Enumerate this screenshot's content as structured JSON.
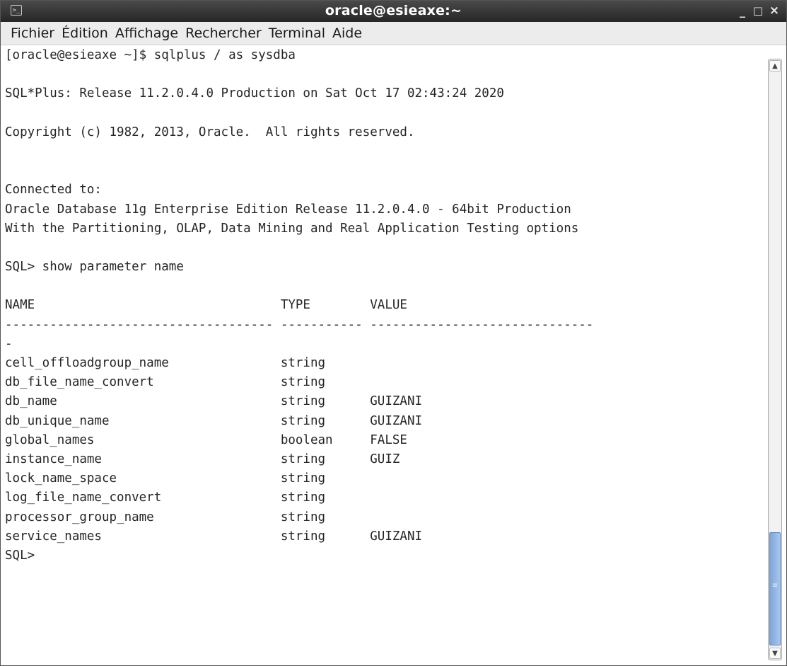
{
  "window": {
    "title": "oracle@esieaxe:~",
    "icon": "terminal-icon",
    "controls": {
      "minimize": "_",
      "maximize": "□",
      "close": "×"
    }
  },
  "menu": [
    {
      "label": "Fichier"
    },
    {
      "label": "Édition"
    },
    {
      "label": "Affichage"
    },
    {
      "label": "Rechercher"
    },
    {
      "label": "Terminal"
    },
    {
      "label": "Aide"
    }
  ],
  "terminal": {
    "lines": [
      "[oracle@esieaxe ~]$ sqlplus / as sysdba",
      "",
      "SQL*Plus: Release 11.2.0.4.0 Production on Sat Oct 17 02:43:24 2020",
      "",
      "Copyright (c) 1982, 2013, Oracle.  All rights reserved.",
      "",
      "",
      "Connected to:",
      "Oracle Database 11g Enterprise Edition Release 11.2.0.4.0 - 64bit Production",
      "With the Partitioning, OLAP, Data Mining and Real Application Testing options",
      "",
      "SQL> show parameter name",
      "",
      "NAME                                 TYPE        VALUE",
      "------------------------------------ ----------- ------------------------------",
      "-",
      "cell_offloadgroup_name               string",
      "db_file_name_convert                 string",
      "db_name                              string      GUIZANI",
      "db_unique_name                       string      GUIZANI",
      "global_names                         boolean     FALSE",
      "instance_name                        string      GUIZ",
      "lock_name_space                      string",
      "log_file_name_convert                string",
      "processor_group_name                 string",
      "service_names                        string      GUIZANI",
      "SQL> "
    ]
  },
  "scrollbar": {
    "up_arrow": "▲",
    "down_arrow": "▼",
    "grip": "≡",
    "position": 1.0
  }
}
